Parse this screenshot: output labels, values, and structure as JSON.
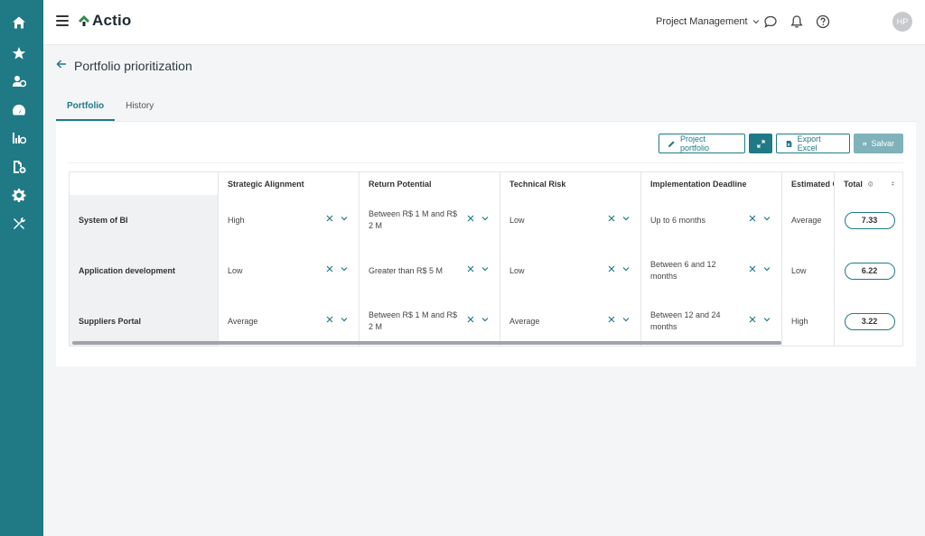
{
  "app": {
    "logo_text": "Actio"
  },
  "header": {
    "project_selector": "Project Management",
    "avatar_initials": "HP"
  },
  "page": {
    "title": "Portfolio prioritization"
  },
  "tabs": [
    {
      "label": "Portfolio",
      "active": true
    },
    {
      "label": "History",
      "active": false
    }
  ],
  "toolbar": {
    "project_portfolio_label": "Project portfolio",
    "export_excel_label": "Export Excel",
    "save_label": "Salvar"
  },
  "table": {
    "columns": [
      "",
      "Strategic Alignment",
      "Return Potential",
      "Technical Risk",
      "Implementation Deadline",
      "Estimated C",
      "Total"
    ],
    "rows": [
      {
        "name": "System of BI",
        "strategic": "High",
        "return": "Between R$ 1 M and R$ 2 M",
        "risk": "Low",
        "deadline": "Up to 6 months",
        "estimated": "Average",
        "total": "7.33"
      },
      {
        "name": "Application development",
        "strategic": "Low",
        "return": "Greater than R$ 5 M",
        "risk": "Low",
        "deadline": "Between 6 and 12 months",
        "estimated": "Low",
        "total": "6.22"
      },
      {
        "name": "Suppliers Portal",
        "strategic": "Average",
        "return": "Between R$ 1 M and R$ 2 M",
        "risk": "Average",
        "deadline": "Between 12 and 24 months",
        "estimated": "High",
        "total": "3.22"
      }
    ]
  },
  "colors": {
    "primary": "#1f7a86",
    "sidebar": "#1f7a86",
    "disabled": "#7fb2ba"
  },
  "icons": {
    "sidebar": [
      "home-icon",
      "star-icon",
      "users-icon",
      "dashboard-icon",
      "chart-icon",
      "document-add-icon",
      "gear-icon",
      "tools-icon"
    ],
    "header": [
      "chat-icon",
      "bell-icon",
      "help-icon"
    ]
  }
}
